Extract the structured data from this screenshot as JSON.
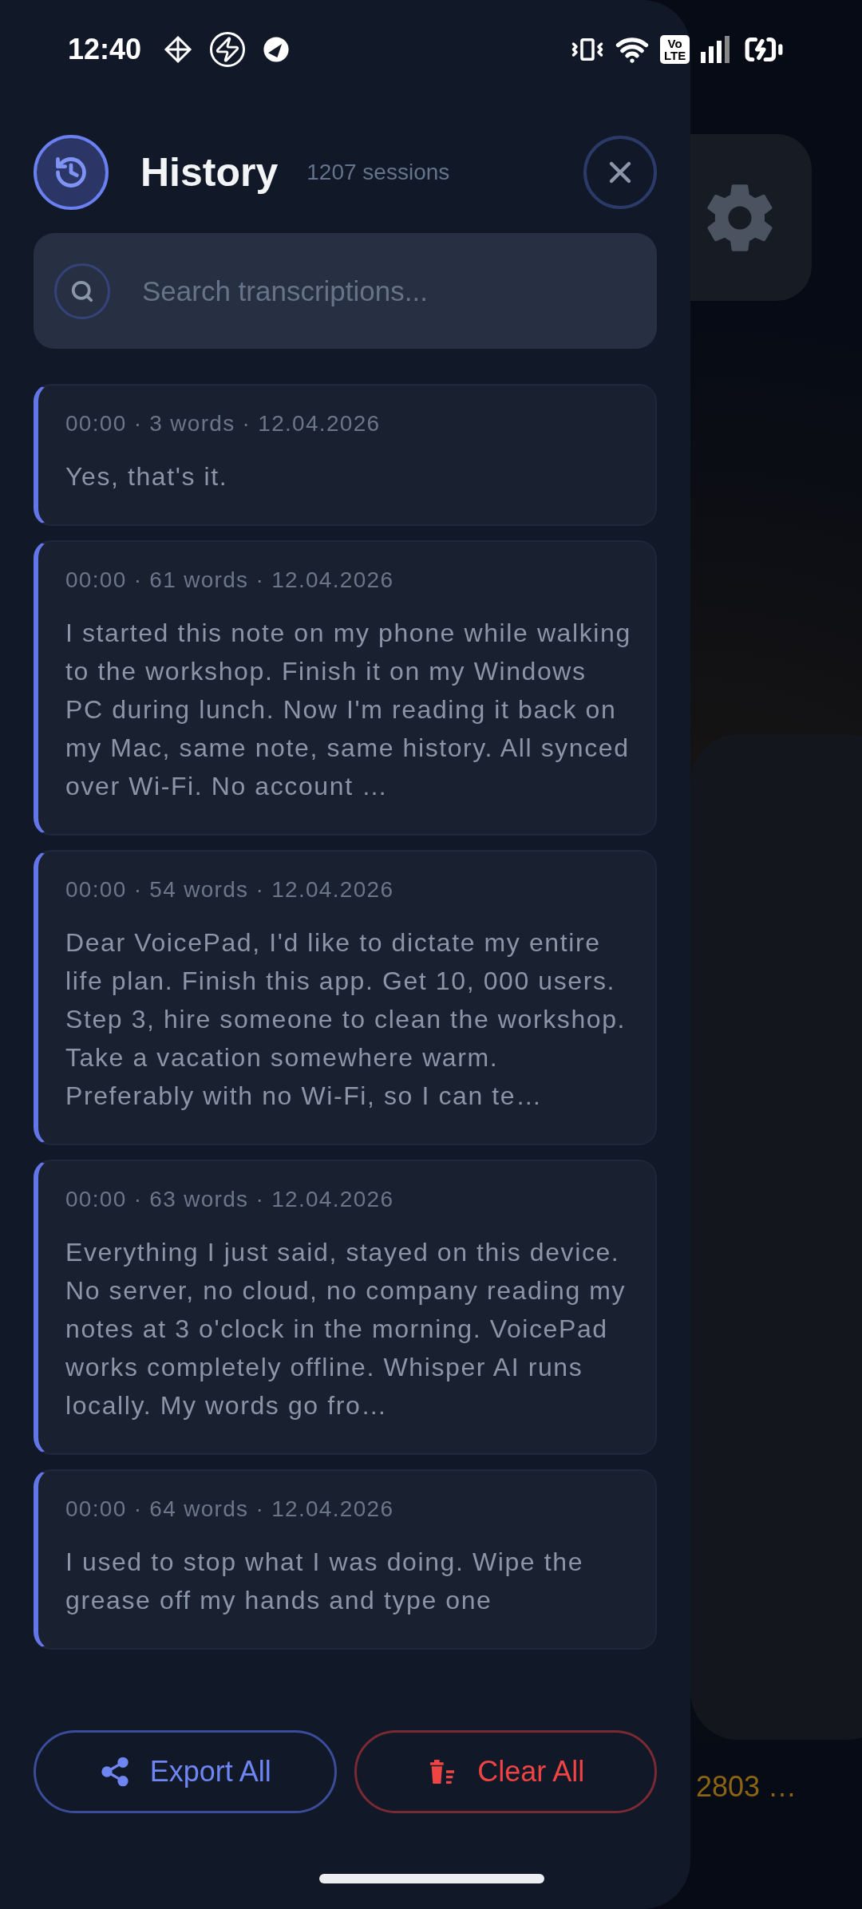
{
  "status_bar": {
    "time": "12:40",
    "network_badge": [
      "Vo",
      "LTE"
    ]
  },
  "history": {
    "title": "History",
    "count": "1207 sessions",
    "search": {
      "placeholder": "Search transcriptions..."
    },
    "sessions": [
      {
        "meta": "00:00 · 3 words · 12.04.2026",
        "text": "Yes, that's it."
      },
      {
        "meta": "00:00 · 61 words · 12.04.2026",
        "text": "I started this note on my phone while walking to the workshop. Finish it on my Windows PC during lunch. Now I'm reading it back on my Mac, same note, same history. All synced over Wi-Fi. No account …"
      },
      {
        "meta": "00:00 · 54 words · 12.04.2026",
        "text": "Dear VoicePad, I'd like to dictate my entire life plan. Finish this app. Get 10, 000 users. Step 3, hire someone to clean the workshop. Take a vacation somewhere warm. Preferably with no Wi-Fi, so I can te…"
      },
      {
        "meta": "00:00 · 63 words · 12.04.2026",
        "text": "Everything I just said, stayed on this device. No server, no cloud, no company reading my notes at 3 o'clock in the morning. VoicePad works completely offline. Whisper AI runs locally. My words go fro…"
      },
      {
        "meta": "00:00 · 64 words · 12.04.2026",
        "text": "I used to stop what I was doing. Wipe the grease off my hands and type one"
      }
    ],
    "buttons": [
      {
        "kind": "export",
        "label": "Export All"
      },
      {
        "kind": "clear",
        "label": "Clear All"
      }
    ]
  },
  "background": {
    "stat_text": "2803 …"
  }
}
